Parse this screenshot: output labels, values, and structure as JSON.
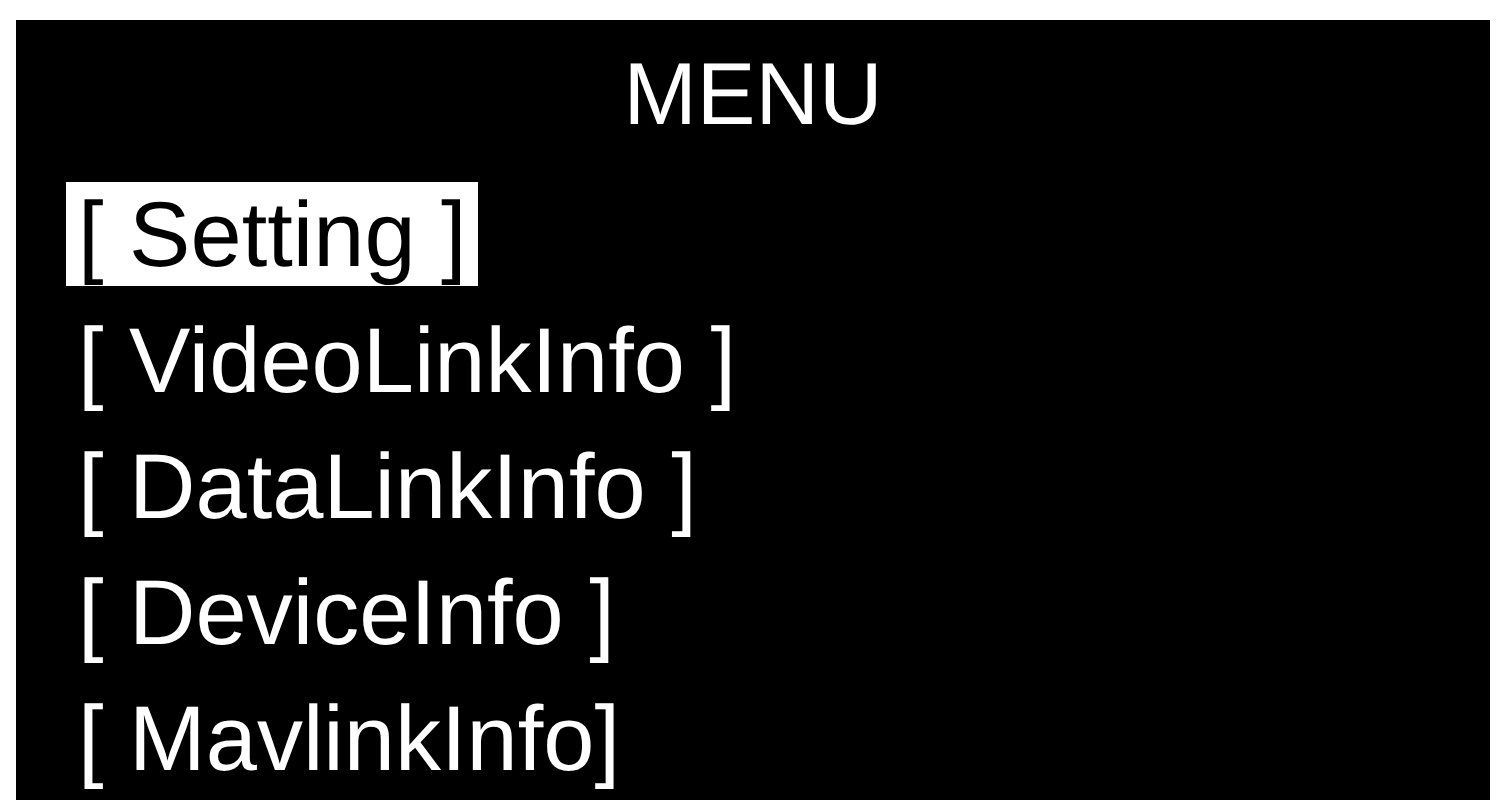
{
  "screen": {
    "title": "MENU"
  },
  "menu_items": [
    {
      "label": "[ Setting ]",
      "selected": true
    },
    {
      "label": "[ VideoLinkInfo ]",
      "selected": false
    },
    {
      "label": "[ DataLinkInfo ]",
      "selected": false
    },
    {
      "label": "[ DeviceInfo ]",
      "selected": false
    },
    {
      "label": "[ MavlinkInfo]",
      "selected": false
    }
  ]
}
